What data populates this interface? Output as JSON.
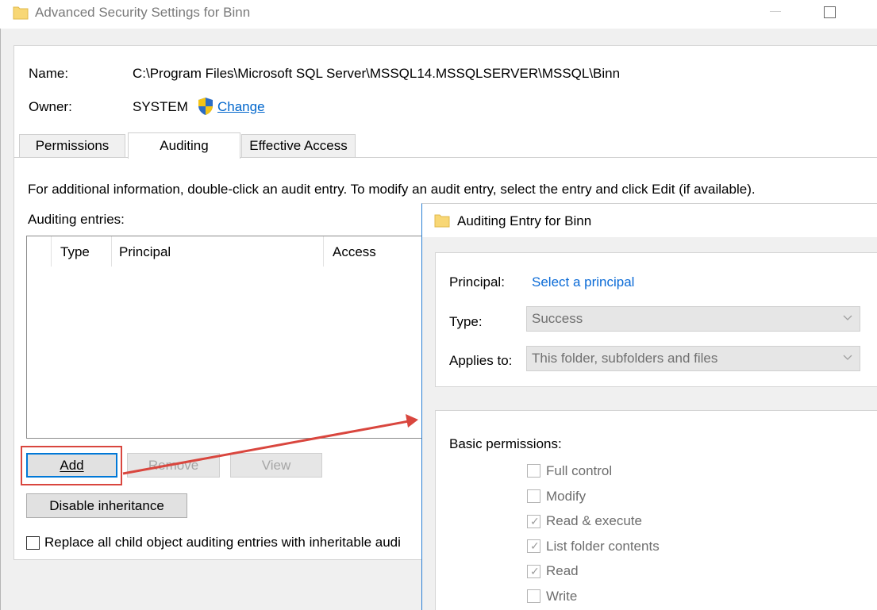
{
  "window": {
    "title": "Advanced Security Settings for Binn"
  },
  "info": {
    "name_label": "Name:",
    "name_value": "C:\\Program Files\\Microsoft SQL Server\\MSSQL14.MSSQLSERVER\\MSSQL\\Binn",
    "owner_label": "Owner:",
    "owner_value": "SYSTEM",
    "change_link": "Change"
  },
  "tabs": [
    {
      "label": "Permissions"
    },
    {
      "label": "Auditing"
    },
    {
      "label": "Effective Access"
    }
  ],
  "auditing": {
    "instructions": "For additional information, double-click an audit entry. To modify an audit entry, select the entry and click Edit (if available).",
    "entries_label": "Auditing entries:",
    "columns": [
      "Type",
      "Principal",
      "Access"
    ],
    "rows": []
  },
  "buttons": {
    "add": "Add",
    "remove": "Remove",
    "view": "View",
    "disable_inheritance": "Disable inheritance"
  },
  "replace_checkbox": {
    "label": "Replace all child object auditing entries with inheritable audi",
    "checked": false
  },
  "dialog": {
    "title": "Auditing Entry for Binn",
    "principal_label": "Principal:",
    "principal_link": "Select a principal",
    "type_label": "Type:",
    "type_value": "Success",
    "applies_label": "Applies to:",
    "applies_value": "This folder, subfolders and files",
    "basic_permissions_label": "Basic permissions:",
    "permissions": [
      {
        "label": "Full control",
        "checked": false
      },
      {
        "label": "Modify",
        "checked": false
      },
      {
        "label": "Read & execute",
        "checked": true
      },
      {
        "label": "List folder contents",
        "checked": true
      },
      {
        "label": "Read",
        "checked": true
      },
      {
        "label": "Write",
        "checked": false
      }
    ]
  },
  "colors": {
    "link": "#0066cc",
    "accent": "#0078d7",
    "annotation": "#d9463e",
    "folder": "#f8d775"
  }
}
